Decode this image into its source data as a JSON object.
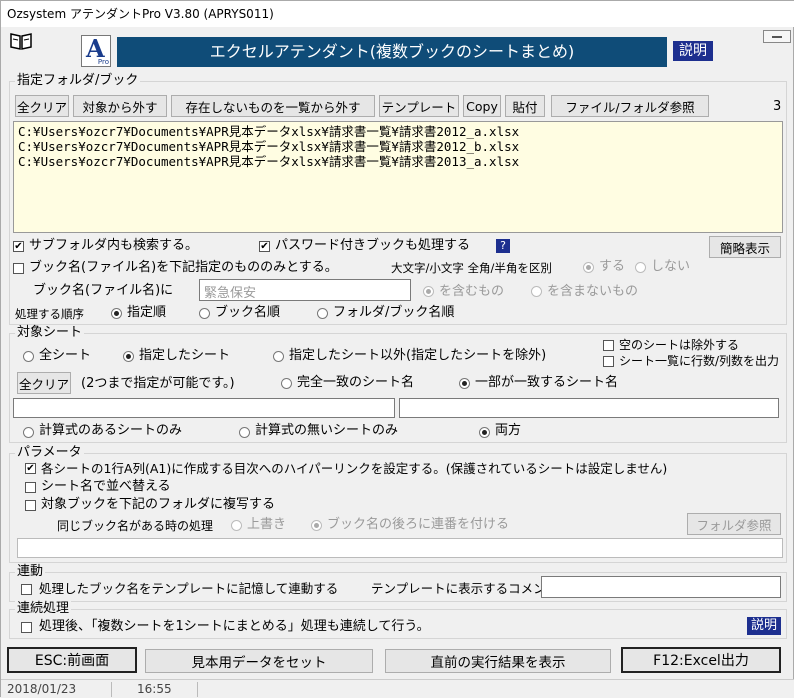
{
  "window": {
    "title": "Ozsystem アテンダントPro V3.80 (APRYS011)"
  },
  "header": {
    "banner_title": "エクセルアテンダント(複数ブックのシートまとめ)",
    "help_label": "説明",
    "logo_letter": "A",
    "logo_sub": "Pro"
  },
  "folder": {
    "group_label": "指定フォルダ/ブック",
    "buttons": {
      "clear": "全クリア",
      "exclude": "対象から外す",
      "remove_missing": "存在しないものを一覧から外す",
      "template": "テンプレート",
      "copy": "Copy",
      "paste": "貼付",
      "browse": "ファイル/フォルダ参照"
    },
    "count": "3",
    "files": [
      "C:¥Users¥ozcr7¥Documents¥APR見本データxlsx¥請求書一覧¥請求書2012_a.xlsx",
      "C:¥Users¥ozcr7¥Documents¥APR見本データxlsx¥請求書一覧¥請求書2012_b.xlsx",
      "C:¥Users¥ozcr7¥Documents¥APR見本データxlsx¥請求書一覧¥請求書2013_a.xlsx"
    ],
    "subfolder_label": "サブフォルダ内も検索する。",
    "password_label": "パスワード付きブックも処理する",
    "help_q": "?",
    "simple_view": "簡略表示",
    "bookname_only_label": "ブック名(ファイル名)を下記指定のもののみとする。",
    "case_label": "大文字/小文字 全角/半角を区別",
    "case_yes": "する",
    "case_no": "しない",
    "bookname_in_label": "ブック名(ファイル名)に",
    "bookname_value": "緊急保安",
    "contain_label": "を含むもの",
    "not_contain_label": "を含まないもの",
    "order_label": "処理する順序",
    "order_specified": "指定順",
    "order_bookname": "ブック名順",
    "order_folder_book": "フォルダ/ブック名順"
  },
  "sheet": {
    "group_label": "対象シート",
    "all": "全シート",
    "specified": "指定したシート",
    "except": "指定したシート以外(指定したシートを除外)",
    "skip_empty": "空のシートは除外する",
    "output_counts": "シート一覧に行数/列数を出力",
    "clear": "全クリア",
    "hint": "(2つまで指定が可能です。)",
    "exact": "完全一致のシート名",
    "partial": "一部が一致するシート名",
    "formula_only": "計算式のあるシートのみ",
    "no_formula_only": "計算式の無いシートのみ",
    "both": "両方"
  },
  "params": {
    "group_label": "パラメータ",
    "hyperlink": "各シートの1行A列(A1)に作成する目次へのハイパーリンクを設定する。(保護されているシートは設定しません)",
    "sort_sheets": "シート名で並べ替える",
    "copy_books": "対象ブックを下記のフォルダに複写する",
    "same_name_label": "同じブック名がある時の処理",
    "overwrite": "上書き",
    "append_number": "ブック名の後ろに連番を付ける",
    "folder_browse": "フォルダ参照"
  },
  "link": {
    "group_label": "連動",
    "remember": "処理したブック名をテンプレートに記憶して連動する",
    "comment_label": "テンプレートに表示するコメント"
  },
  "chain": {
    "group_label": "連続処理",
    "label": "処理後、「複数シートを1シートにまとめる」処理も連続して行う。",
    "help": "説明"
  },
  "footer": {
    "esc": "ESC:前画面",
    "sample": "見本用データをセット",
    "last_result": "直前の実行結果を表示",
    "f12": "F12:Excel出力"
  },
  "status": {
    "date": "2018/01/23",
    "time": "16:55"
  }
}
